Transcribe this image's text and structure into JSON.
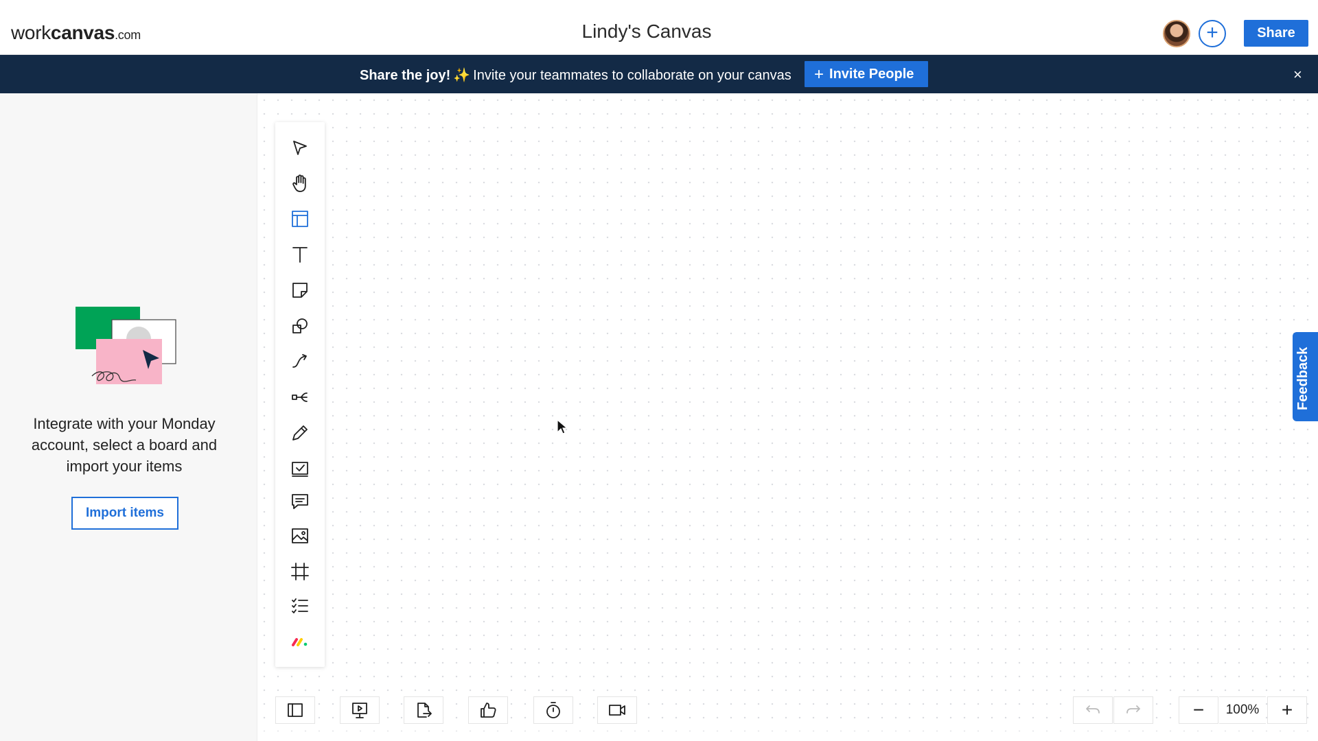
{
  "header": {
    "logo_prefix": "work",
    "logo_main": "canvas",
    "logo_suffix": ".com",
    "canvas_title": "Lindy's Canvas",
    "add_label": "+",
    "share_label": "Share"
  },
  "banner": {
    "lead": "Share the joy!",
    "spark": "✨",
    "text": "Invite your teammates to collaborate on your canvas",
    "invite_plus": "+",
    "invite_label": "Invite People",
    "close": "×"
  },
  "side_panel": {
    "message": "Integrate with your Monday account, select a board and import your items",
    "import_label": "Import items"
  },
  "toolbar": {
    "tools": [
      "select-icon",
      "hand-icon",
      "template-icon",
      "text-icon",
      "sticky-note-icon",
      "shapes-icon",
      "connector-icon",
      "mind-map-icon",
      "pen-icon",
      "checkbox-icon",
      "comment-icon",
      "image-icon",
      "frame-icon",
      "checklist-icon",
      "monday-icon"
    ]
  },
  "feedback_label": "Feedback",
  "bottom_bar": {
    "zoom_level": "100%",
    "zoom_minus": "−",
    "zoom_plus": "+"
  },
  "colors": {
    "accent": "#1f6fd9",
    "banner_bg": "#132a46",
    "illustration_green": "#00a356",
    "illustration_pink": "#f8b4c8"
  }
}
